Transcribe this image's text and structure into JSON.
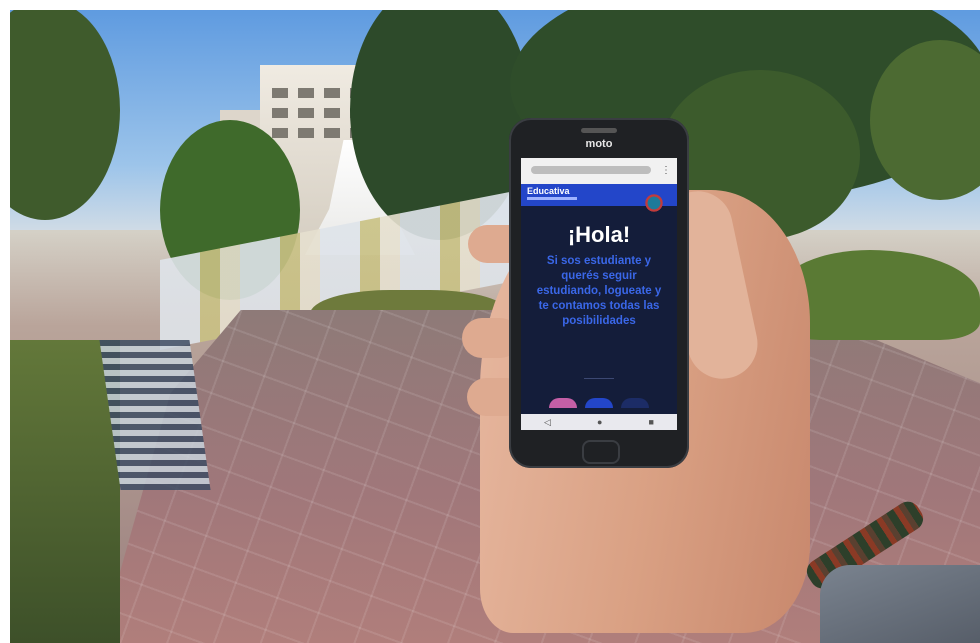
{
  "phone": {
    "brand": "moto",
    "screen": {
      "site_logo": "Educativa",
      "greeting": "¡Hola!",
      "message": "Si sos estudiante y querés seguir estudiando, logueate y te contamos todas las posibilidades",
      "nav_icons": [
        "◁",
        "●",
        "■"
      ],
      "colors": {
        "header": "#2346c9",
        "background": "#141d3a",
        "message_text": "#3a67e8",
        "greeting_text": "#ffffff"
      }
    }
  }
}
